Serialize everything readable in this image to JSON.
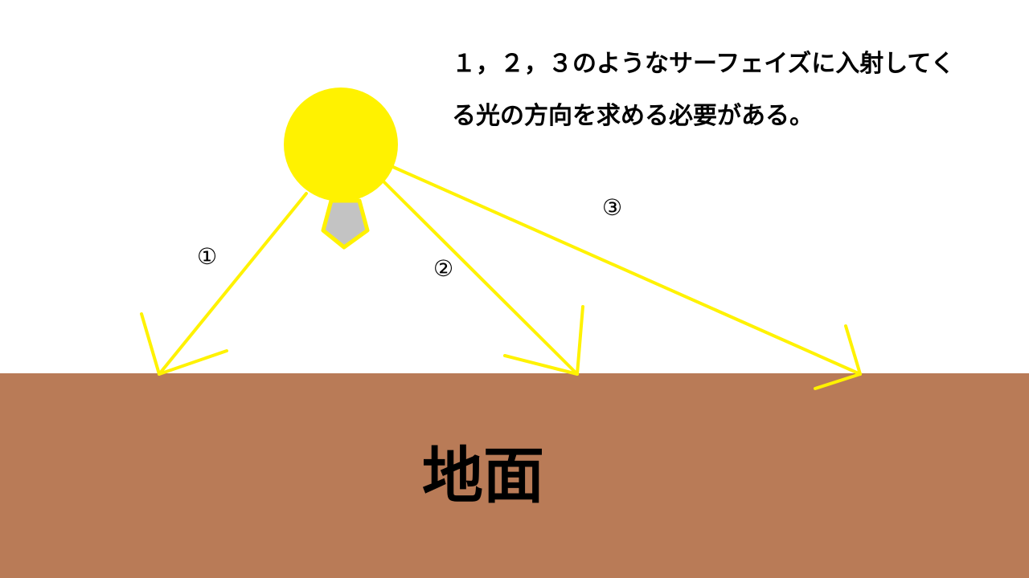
{
  "caption": {
    "line1": "１，２，３のようなサーフェイズに入射してく",
    "line2": "る光の方向を求める必要がある。"
  },
  "ground": {
    "label": "地面",
    "color": "#b97b57"
  },
  "light": {
    "bulb_color": "#fff200",
    "base_color": "#c3c3c3",
    "ray_color": "#fff200"
  },
  "rays": [
    {
      "label": "①"
    },
    {
      "label": "②"
    },
    {
      "label": "③"
    }
  ]
}
